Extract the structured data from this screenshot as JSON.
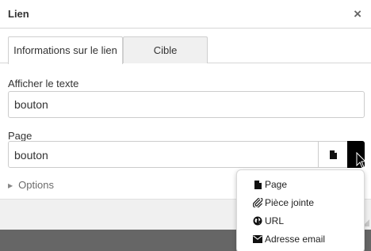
{
  "dialog": {
    "title": "Lien",
    "close_glyph": "×"
  },
  "tabs": [
    {
      "label": "Informations sur le lien",
      "active": true
    },
    {
      "label": "Cible",
      "active": false
    }
  ],
  "form": {
    "text_label": "Afficher le texte",
    "text_value": "bouton",
    "page_label": "Page",
    "page_value": "bouton",
    "options_label": "Options"
  },
  "menu": {
    "items": [
      {
        "label": "Page",
        "icon": "file-icon"
      },
      {
        "label": "Pièce jointe",
        "icon": "paperclip-icon"
      },
      {
        "label": "URL",
        "icon": "globe-icon"
      },
      {
        "label": "Adresse email",
        "icon": "envelope-icon"
      }
    ]
  },
  "colors": {
    "overlay": "#666666",
    "footer": "#f0f0f0",
    "inactive_tab": "#f0f0f0",
    "dark_button": "#000000"
  }
}
